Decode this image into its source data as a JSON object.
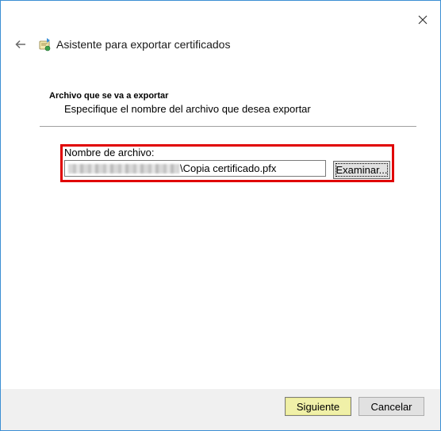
{
  "wizard": {
    "title": "Asistente para exportar certificados"
  },
  "section": {
    "title": "Archivo que se va a exportar",
    "subtitle": "Especifique el nombre del archivo que desea exportar"
  },
  "file": {
    "label": "Nombre de archivo:",
    "value_suffix": "\\Copia certificado.pfx",
    "browse_label": "Examinar..."
  },
  "footer": {
    "next_label": "Siguiente",
    "cancel_label": "Cancelar"
  },
  "colors": {
    "highlight": "#e00000",
    "next_button": "#f0f0a8",
    "window_border": "#3c8fd4"
  },
  "icons": {
    "close": "close-icon",
    "back": "back-arrow-icon",
    "wizard": "certificate-wizard-icon"
  }
}
